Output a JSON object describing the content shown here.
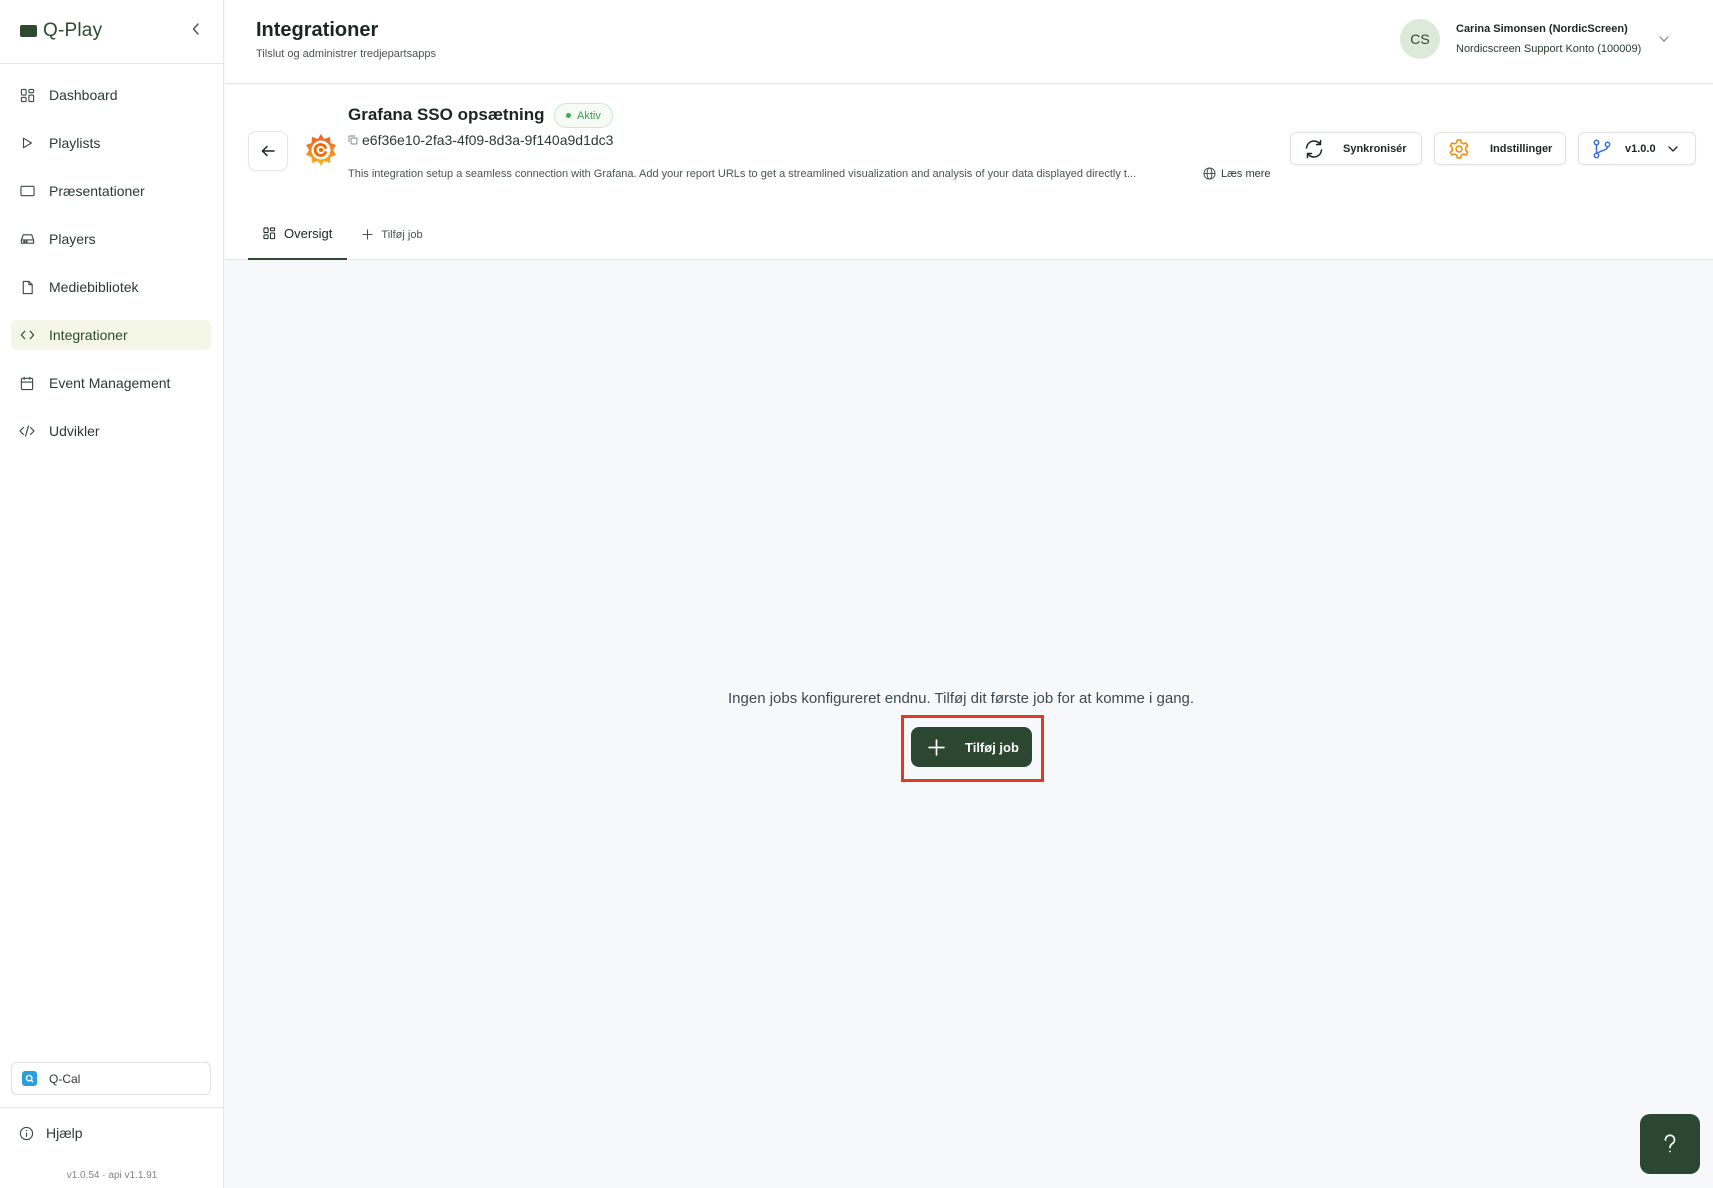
{
  "app": {
    "name": "Q-Play",
    "version": "v1.0.54 · api v1.1.91"
  },
  "sidebar": {
    "items": [
      {
        "label": "Dashboard",
        "icon": "dashboard-icon"
      },
      {
        "label": "Playlists",
        "icon": "play-icon"
      },
      {
        "label": "Præsentationer",
        "icon": "screen-icon"
      },
      {
        "label": "Players",
        "icon": "player-icon"
      },
      {
        "label": "Mediebibliotek",
        "icon": "file-icon"
      },
      {
        "label": "Integrationer",
        "icon": "code-brackets-icon",
        "active": true
      },
      {
        "label": "Event Management",
        "icon": "calendar-icon"
      },
      {
        "label": "Udvikler",
        "icon": "code-slash-icon"
      }
    ],
    "qcal_label": "Q-Cal",
    "help_label": "Hjælp"
  },
  "header": {
    "title": "Integrationer",
    "subtitle": "Tilslut og administrer tredjepartsapps"
  },
  "user": {
    "initials": "CS",
    "name": "Carina Simonsen (NordicScreen)",
    "account": "Nordicscreen Support Konto (100009)"
  },
  "integration": {
    "title": "Grafana SSO opsætning",
    "status": "Aktiv",
    "id": "e6f36e10-2fa3-4f09-8d3a-9f140a9d1dc3",
    "description": "This integration setup a seamless connection with Grafana. Add your report URLs to get a streamlined visualization and analysis of your data displayed directly t...",
    "read_more": "Læs mere",
    "sync_label": "Synkronisér",
    "settings_label": "Indstillinger",
    "version_label": "v1.0.0"
  },
  "tabs": [
    {
      "label": "Oversigt",
      "active": true
    },
    {
      "label": "Tilføj job",
      "active": false
    }
  ],
  "empty_state": {
    "message": "Ingen jobs konfigureret endnu. Tilføj dit første job for at komme i gang.",
    "button_label": "Tilføj job"
  },
  "colors": {
    "brand": "#2d4a31",
    "active_nav_bg": "#f4f7e6",
    "status_green": "#3a9b4a",
    "highlight": "#e33a1f",
    "grafana_orange": "#f46800"
  }
}
